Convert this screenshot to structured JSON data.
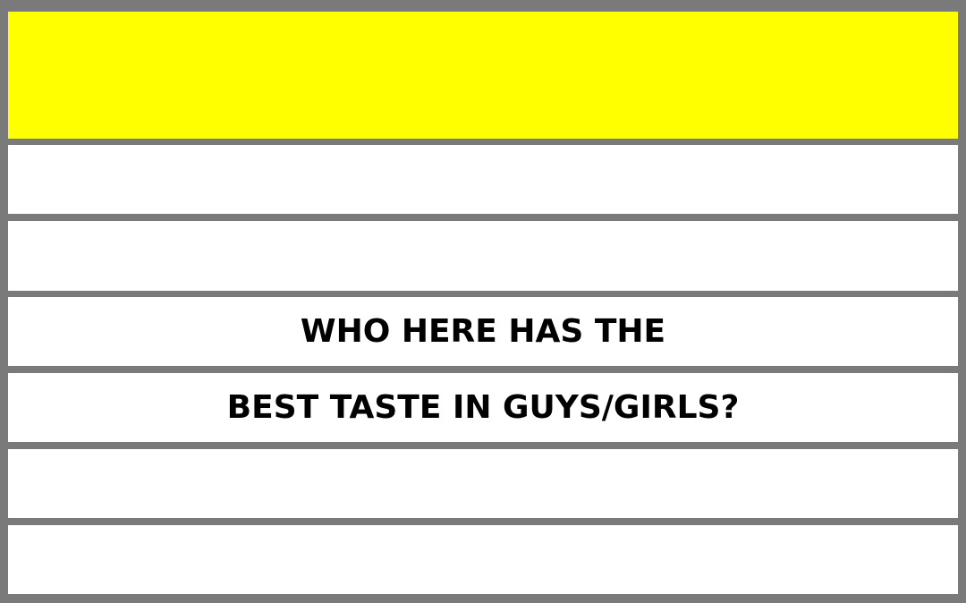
{
  "colors": {
    "frame": "#7a7a7a",
    "header_band": "#ffff00",
    "row_band": "#ffffff",
    "text": "#000000"
  },
  "question": {
    "line1": "WHO HERE HAS THE",
    "line2": "BEST TASTE IN GUYS/GIRLS?"
  }
}
